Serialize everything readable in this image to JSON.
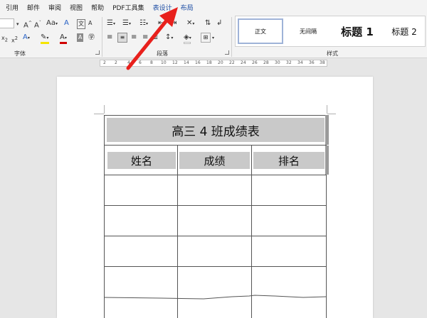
{
  "menu": {
    "items": [
      "引用",
      "邮件",
      "审阅",
      "视图",
      "帮助",
      "PDF工具集",
      "表设计",
      "布局"
    ]
  },
  "ribbon": {
    "font_group_label": "字体",
    "paragraph_group_label": "段落",
    "styles_group_label": "样式",
    "styles": [
      "正文",
      "无间隔",
      "标题 1",
      "标题 2"
    ]
  },
  "ruler": {
    "numbers": [
      "2",
      "2",
      "4",
      "6",
      "8",
      "10",
      "12",
      "14",
      "16",
      "18",
      "20",
      "22",
      "24",
      "26",
      "28",
      "30",
      "32",
      "34",
      "36",
      "38"
    ]
  },
  "table": {
    "title": "高三 4 班成绩表",
    "headers": [
      "姓名",
      "成绩",
      "排名"
    ],
    "empty_rows": 5
  },
  "colors": {
    "accent_tab": "#1f4fa5",
    "header_fill": "#c9c9c9",
    "arrow": "#e8201c"
  }
}
